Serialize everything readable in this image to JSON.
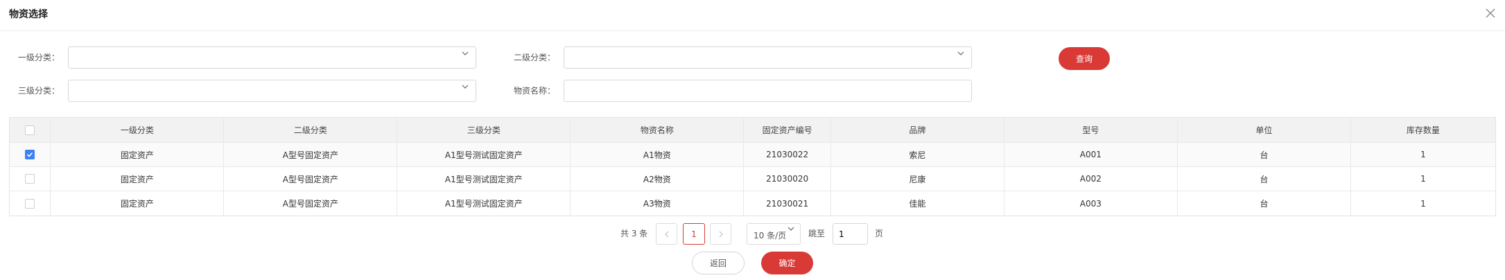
{
  "dialog": {
    "title": "物资选择"
  },
  "filters": {
    "level1_label": "一级分类：",
    "level2_label": "二级分类：",
    "level3_label": "三级分类：",
    "name_label": "物资名称：",
    "level1_value": "",
    "level2_value": "",
    "level3_value": "",
    "name_value": "",
    "query_button": "查询"
  },
  "table": {
    "columns": [
      "一级分类",
      "二级分类",
      "三级分类",
      "物资名称",
      "固定资产编号",
      "品牌",
      "型号",
      "单位",
      "库存数量"
    ],
    "rows": [
      {
        "checked": true,
        "cells": [
          "固定资产",
          "A型号固定资产",
          "A1型号测试固定资产",
          "A1物资",
          "21030022",
          "索尼",
          "A001",
          "台",
          "1"
        ]
      },
      {
        "checked": false,
        "cells": [
          "固定资产",
          "A型号固定资产",
          "A1型号测试固定资产",
          "A2物资",
          "21030020",
          "尼康",
          "A002",
          "台",
          "1"
        ]
      },
      {
        "checked": false,
        "cells": [
          "固定资产",
          "A型号固定资产",
          "A1型号测试固定资产",
          "A3物资",
          "21030021",
          "佳能",
          "A003",
          "台",
          "1"
        ]
      }
    ]
  },
  "pagination": {
    "total_text": "共 3 条",
    "current_page": "1",
    "page_size": "10 条/页",
    "jump_label": "跳至",
    "jump_value": "1",
    "page_unit": "页"
  },
  "footer": {
    "back_button": "返回",
    "confirm_button": "确定"
  },
  "colors": {
    "accent": "#d93a36",
    "checkbox_checked": "#3b82f6",
    "header_bg": "#f2f2f2"
  }
}
